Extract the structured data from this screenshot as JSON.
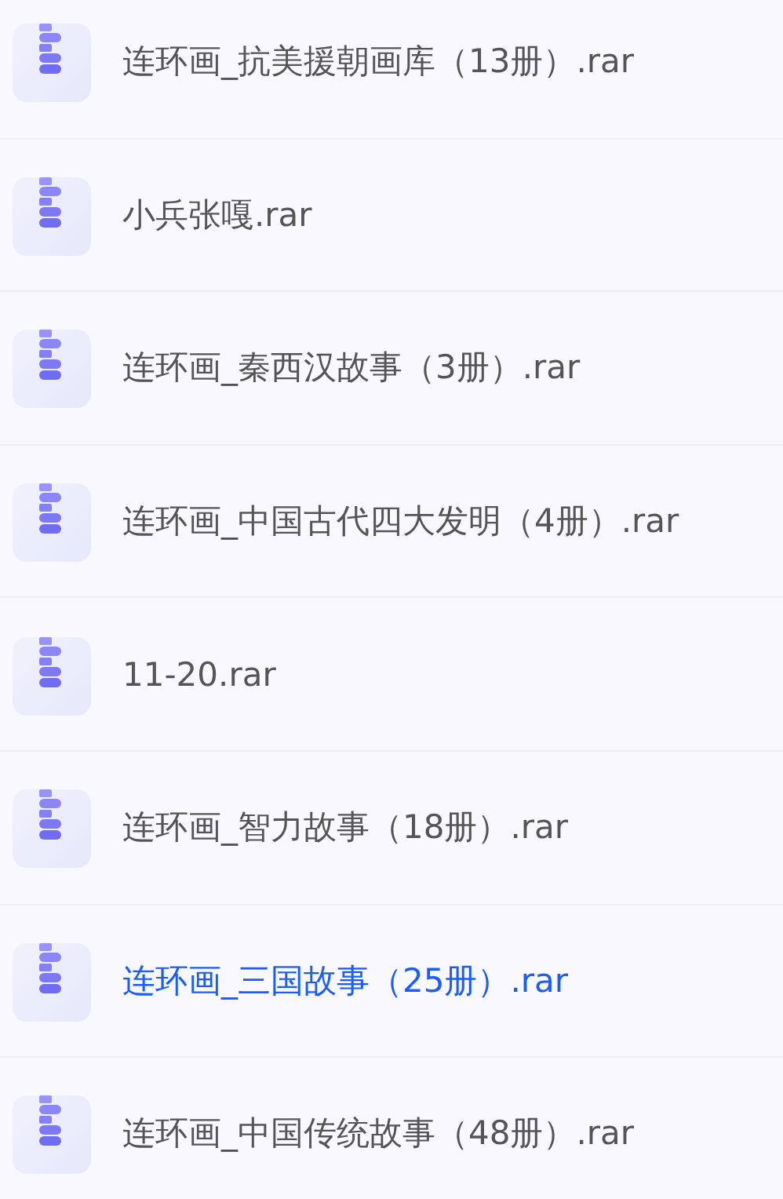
{
  "files": [
    {
      "name": "连环画_抗美援朝画库（13册）.rar",
      "selected": false
    },
    {
      "name": "小兵张嘎.rar",
      "selected": false
    },
    {
      "name": "连环画_秦西汉故事（3册）.rar",
      "selected": false
    },
    {
      "name": "连环画_中国古代四大发明（4册）.rar",
      "selected": false
    },
    {
      "name": "11-20.rar",
      "selected": false
    },
    {
      "name": "连环画_智力故事（18册）.rar",
      "selected": false
    },
    {
      "name": "连环画_三国故事（25册）.rar",
      "selected": true
    },
    {
      "name": "连环画_中国传统故事（48册）.rar",
      "selected": false
    }
  ]
}
